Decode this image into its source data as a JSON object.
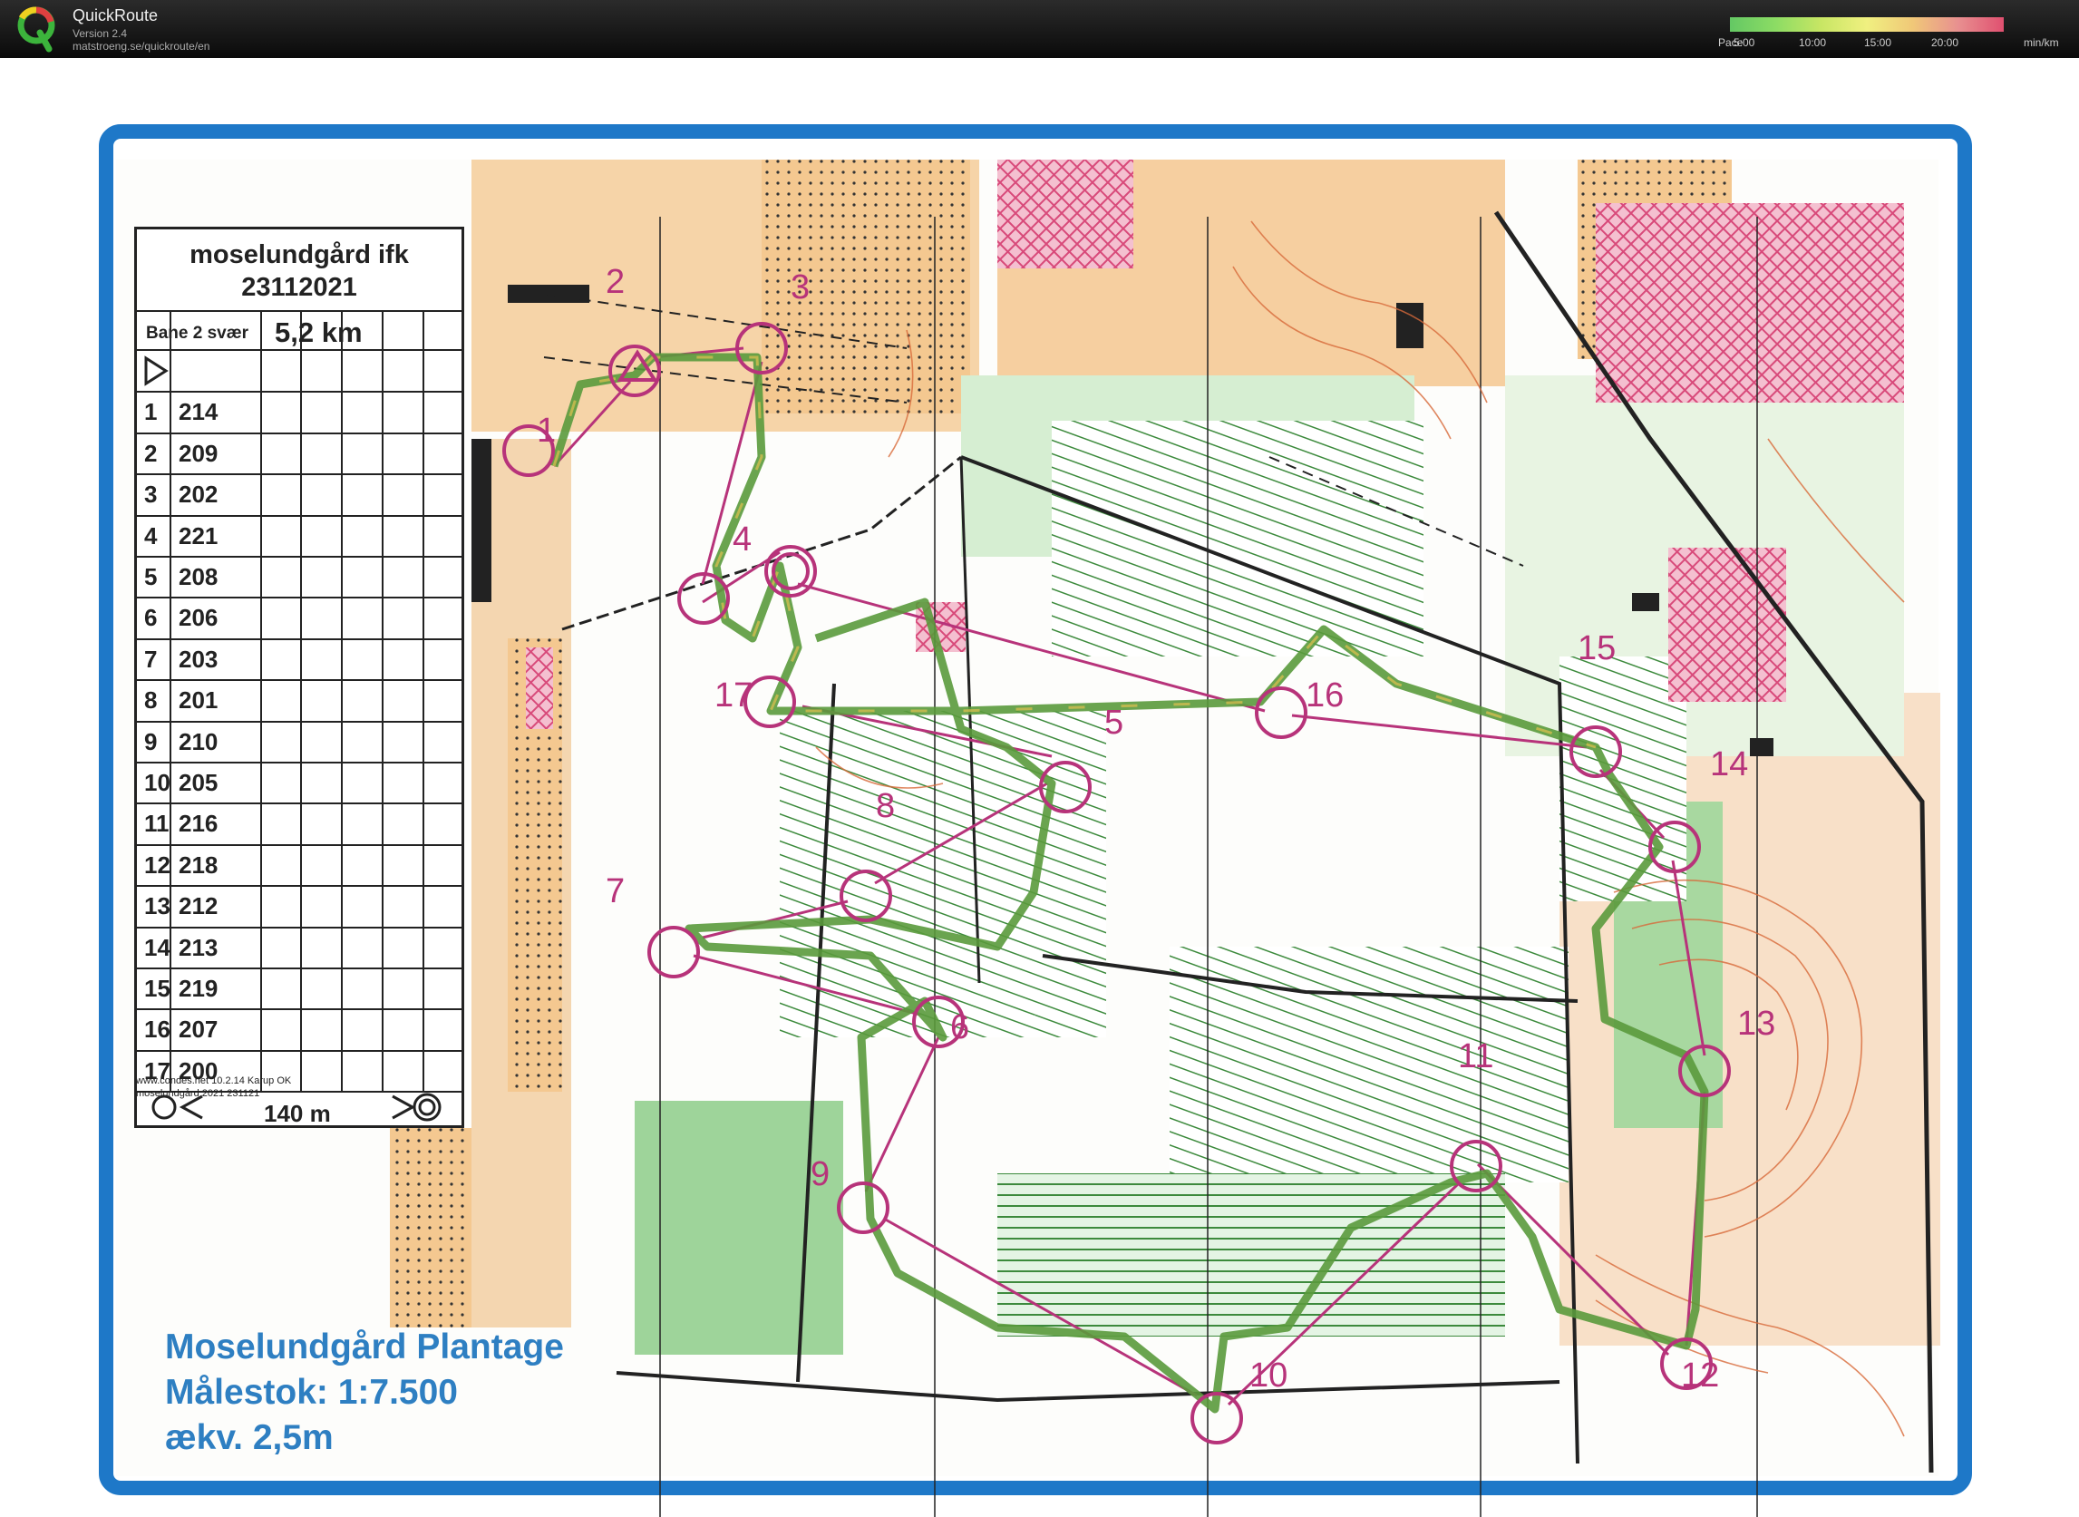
{
  "app": {
    "title": "QuickRoute",
    "version": "Version 2.4",
    "url": "matstroeng.se/quickroute/en"
  },
  "pace_legend": {
    "label": "Pace",
    "ticks": [
      "5:00",
      "10:00",
      "15:00",
      "20:00"
    ],
    "unit": "min/km"
  },
  "map": {
    "club_line1": "moselundgård ifk",
    "club_line2": "23112021",
    "course": "Bane 2 svær",
    "length": "5,2 km",
    "controls": [
      {
        "num": "1",
        "code": "214"
      },
      {
        "num": "2",
        "code": "209"
      },
      {
        "num": "3",
        "code": "202"
      },
      {
        "num": "4",
        "code": "221"
      },
      {
        "num": "5",
        "code": "208"
      },
      {
        "num": "6",
        "code": "206"
      },
      {
        "num": "7",
        "code": "203"
      },
      {
        "num": "8",
        "code": "201"
      },
      {
        "num": "9",
        "code": "210"
      },
      {
        "num": "10",
        "code": "205"
      },
      {
        "num": "11",
        "code": "216"
      },
      {
        "num": "12",
        "code": "218"
      },
      {
        "num": "13",
        "code": "212"
      },
      {
        "num": "14",
        "code": "213"
      },
      {
        "num": "15",
        "code": "219"
      },
      {
        "num": "16",
        "code": "207"
      },
      {
        "num": "17",
        "code": "200"
      }
    ],
    "finish_distance": "140 m",
    "credit_line1": "www.condes.net 10.2.14 Karup OK",
    "credit_line2": "moselundgård 2021 231121",
    "area_name": "Moselundgård Plantage",
    "scale": "Målestok: 1:7.500",
    "contour": "ækv. 2,5m",
    "map_labels": [
      "1",
      "2",
      "3",
      "4",
      "5",
      "6",
      "7",
      "8",
      "9",
      "10",
      "11",
      "12",
      "13",
      "14",
      "15",
      "16",
      "17"
    ]
  },
  "colors": {
    "frame_blue": "#1e78c8",
    "control_magenta": "#b7337a",
    "route_green": "#5a9a3c",
    "open_orange": "#f2c48a",
    "forest_green": "#b8e0b0",
    "urban_pink": "#e0628a"
  }
}
